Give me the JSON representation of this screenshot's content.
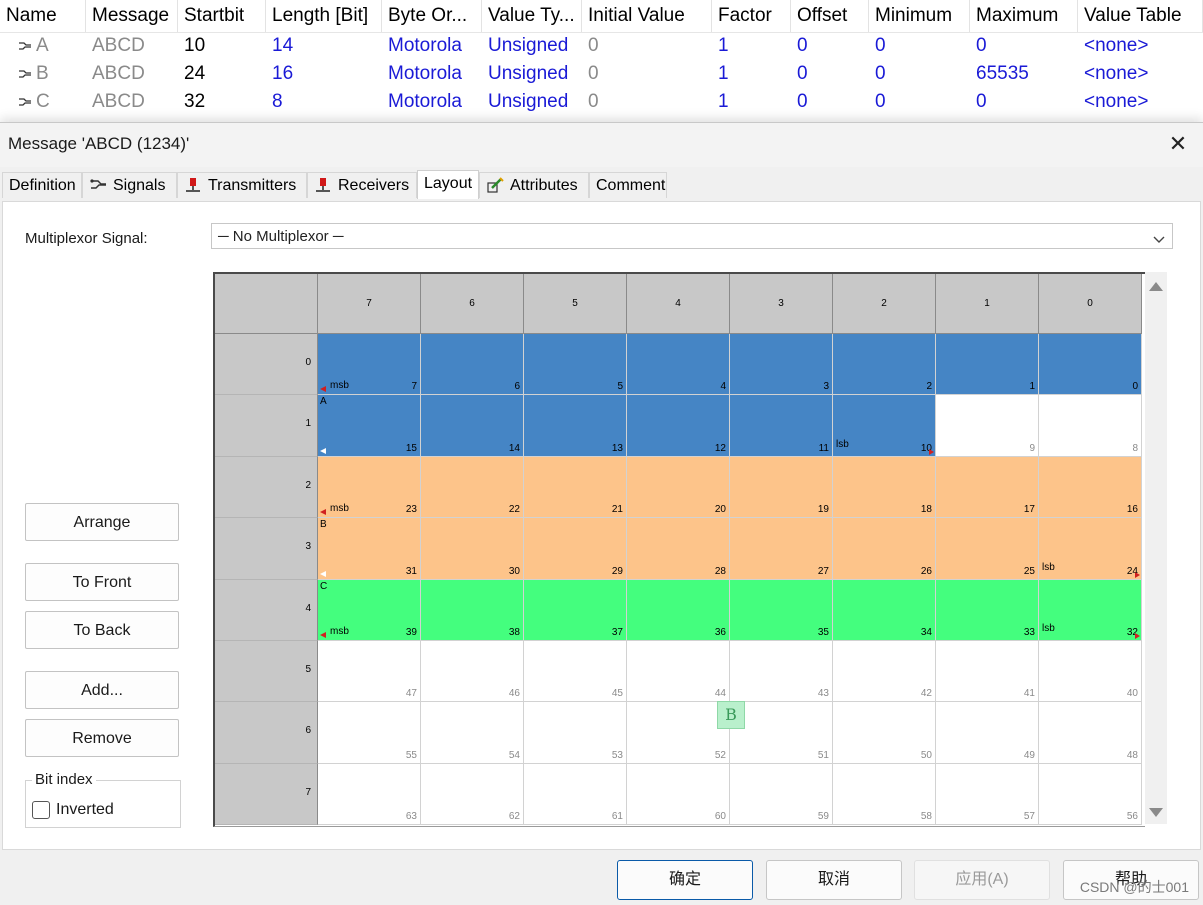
{
  "signal_table": {
    "columns": [
      "Name",
      "Message",
      "Startbit",
      "Length [Bit]",
      "Byte Or...",
      "Value Ty...",
      "Initial Value",
      "Factor",
      "Offset",
      "Minimum",
      "Maximum",
      "Value Table"
    ],
    "rows": [
      {
        "name": "A",
        "message": "ABCD",
        "startbit": "10",
        "length": "14",
        "byte_order": "Motorola",
        "value_type": "Unsigned",
        "initial": "0",
        "factor": "1",
        "offset": "0",
        "minimum": "0",
        "maximum": "0",
        "value_table": "<none>"
      },
      {
        "name": "B",
        "message": "ABCD",
        "startbit": "24",
        "length": "16",
        "byte_order": "Motorola",
        "value_type": "Unsigned",
        "initial": "0",
        "factor": "1",
        "offset": "0",
        "minimum": "0",
        "maximum": "65535",
        "value_table": "<none>"
      },
      {
        "name": "C",
        "message": "ABCD",
        "startbit": "32",
        "length": "8",
        "byte_order": "Motorola",
        "value_type": "Unsigned",
        "initial": "0",
        "factor": "1",
        "offset": "0",
        "minimum": "0",
        "maximum": "0",
        "value_table": "<none>"
      }
    ],
    "signal_icon": "signal-icon"
  },
  "dialog": {
    "title": "Message 'ABCD (1234)'",
    "close_icon": "close-icon",
    "tabs": [
      {
        "label": "Definition",
        "icon": ""
      },
      {
        "label": "Signals",
        "icon": "signals-icon"
      },
      {
        "label": "Transmitters",
        "icon": "transmitter-icon"
      },
      {
        "label": "Receivers",
        "icon": "receiver-icon"
      },
      {
        "label": "Layout",
        "icon": ""
      },
      {
        "label": "Attributes",
        "icon": "attributes-icon"
      },
      {
        "label": "Comment",
        "icon": ""
      }
    ],
    "active_tab": "Layout"
  },
  "layout": {
    "mux_label": "Multiplexor Signal:",
    "mux_value": "─ No Multiplexor ─",
    "buttons": {
      "arrange": "Arrange",
      "to_front": "To Front",
      "to_back": "To Back",
      "add": "Add...",
      "remove": "Remove"
    },
    "bit_index": {
      "label": "Bit index",
      "inverted_label": "Inverted",
      "inverted_checked": false
    },
    "grid": {
      "col_headers": [
        "7",
        "6",
        "5",
        "4",
        "3",
        "2",
        "1",
        "0"
      ],
      "row_headers": [
        "0",
        "1",
        "2",
        "3",
        "4",
        "5",
        "6",
        "7"
      ],
      "signal_colors": {
        "A": "#4585c5",
        "B": "#fdc48a",
        "C": "#44fe7e",
        "free": "#ffffff"
      },
      "signals": [
        {
          "name": "A",
          "bits": [
            7,
            6,
            5,
            4,
            3,
            2,
            1,
            0,
            15,
            14,
            13,
            12,
            11,
            10
          ],
          "msb": 7,
          "lsb": 10
        },
        {
          "name": "B",
          "bits": [
            23,
            22,
            21,
            20,
            19,
            18,
            17,
            16,
            31,
            30,
            29,
            28,
            27,
            26,
            25,
            24
          ],
          "msb": 23,
          "lsb": 24
        },
        {
          "name": "C",
          "bits": [
            39,
            38,
            37,
            36,
            35,
            34,
            33,
            32
          ],
          "msb": 39,
          "lsb": 32
        }
      ],
      "msb_text": "msb",
      "lsb_text": "lsb",
      "drag_label": "B"
    }
  },
  "footer": {
    "ok": "确定",
    "cancel": "取消",
    "apply": "应用(A)",
    "help": "帮助"
  },
  "watermark": "CSDN @的士001"
}
